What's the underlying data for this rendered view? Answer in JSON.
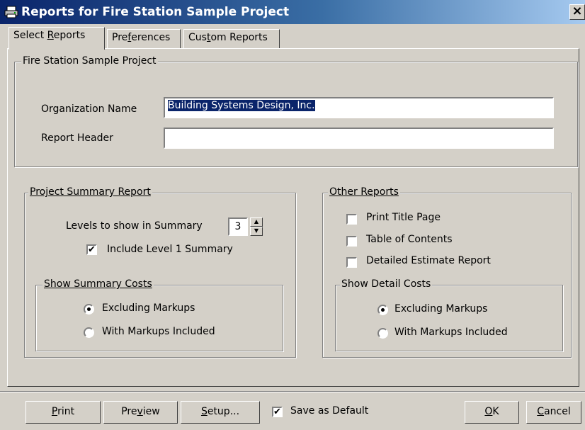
{
  "window": {
    "title": "Reports for Fire Station Sample Project",
    "icon": "printer-icon",
    "close": "×"
  },
  "tabs": [
    {
      "pre": "Select ",
      "u": "R",
      "post": "eports"
    },
    {
      "pre": "Pre",
      "u": "f",
      "post": "erences"
    },
    {
      "pre": "Cus",
      "u": "t",
      "post": "om Reports"
    }
  ],
  "project": {
    "legend": "Fire Station Sample Project",
    "org_label": "Organization Name",
    "org_value": "Building Systems Design, Inc.",
    "header_label": "Report Header",
    "header_value": ""
  },
  "summary": {
    "legend": "Project Summary Report",
    "levels_label": "Levels to show in Summary",
    "levels_value": "3",
    "include_label": "Include Level 1 Summary",
    "include_checked": "✔",
    "costs_legend": "Show Summary Costs",
    "excl_label": "Excluding Markups",
    "with_label": "With Markups Included"
  },
  "other": {
    "legend": "Other Reports",
    "title_page": "Print Title Page",
    "toc": "Table of Contents",
    "detailed": "Detailed Estimate Report",
    "costs_legend": "Show Detail Costs",
    "excl_label": "Excluding Markups",
    "with_label": "With Markups Included"
  },
  "footer": {
    "print": {
      "u": "P",
      "post": "rint"
    },
    "preview": {
      "pre": "Pre",
      "u": "v",
      "post": "iew"
    },
    "setup": {
      "u": "S",
      "post": "etup..."
    },
    "save_default": "Save as Default",
    "save_checked": "✔",
    "ok": {
      "u": "O",
      "post": "K"
    },
    "cancel": {
      "u": "C",
      "post": "ancel"
    }
  }
}
